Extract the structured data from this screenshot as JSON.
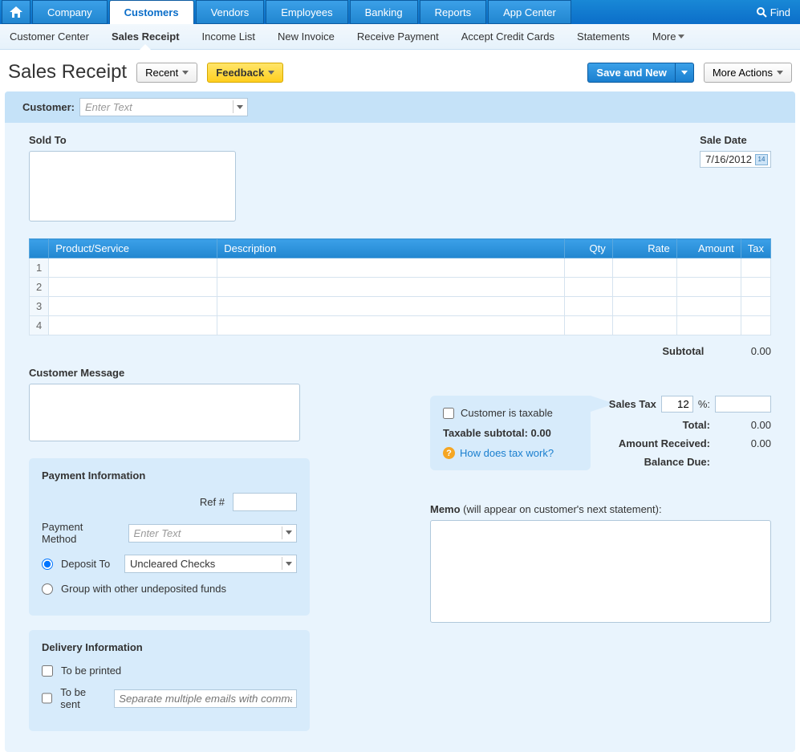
{
  "topnav": {
    "tabs": [
      "Company",
      "Customers",
      "Vendors",
      "Employees",
      "Banking",
      "Reports",
      "App Center"
    ],
    "active": "Customers",
    "find": "Find"
  },
  "subnav": {
    "items": [
      "Customer Center",
      "Sales Receipt",
      "Income List",
      "New Invoice",
      "Receive Payment",
      "Accept Credit Cards",
      "Statements"
    ],
    "active": "Sales Receipt",
    "more": "More"
  },
  "titlebar": {
    "title": "Sales Receipt",
    "recent": "Recent",
    "feedback": "Feedback",
    "save_new": "Save and New",
    "more_actions": "More Actions"
  },
  "customer_bar": {
    "label": "Customer:",
    "placeholder": "Enter Text"
  },
  "sold_to": {
    "label": "Sold To"
  },
  "sale_date": {
    "label": "Sale Date",
    "value": "7/16/2012"
  },
  "table": {
    "headers": {
      "product": "Product/Service",
      "description": "Description",
      "qty": "Qty",
      "rate": "Rate",
      "amount": "Amount",
      "tax": "Tax"
    },
    "rows": [
      "1",
      "2",
      "3",
      "4"
    ]
  },
  "totals": {
    "subtotal_label": "Subtotal",
    "subtotal_value": "0.00",
    "sales_tax_label": "Sales Tax",
    "sales_tax_rate": "12",
    "percent": "%:",
    "total_label": "Total:",
    "total_value": "0.00",
    "amount_received_label": "Amount Received:",
    "amount_received_value": "0.00",
    "balance_due_label": "Balance Due:"
  },
  "cust_msg": {
    "label": "Customer Message"
  },
  "tax_box": {
    "taxable": "Customer is taxable",
    "subtotal": "Taxable subtotal: 0.00",
    "help": "How does tax work?"
  },
  "payment": {
    "title": "Payment Information",
    "ref": "Ref #",
    "method_label": "Payment Method",
    "method_placeholder": "Enter Text",
    "deposit_to": "Deposit To",
    "deposit_value": "Uncleared Checks",
    "group": "Group with other undeposited funds"
  },
  "delivery": {
    "title": "Delivery Information",
    "printed": "To be printed",
    "sent": "To be sent",
    "email_placeholder": "Separate multiple emails with commas"
  },
  "memo": {
    "label": "Memo",
    "suffix": " (will appear on customer's next statement):"
  }
}
